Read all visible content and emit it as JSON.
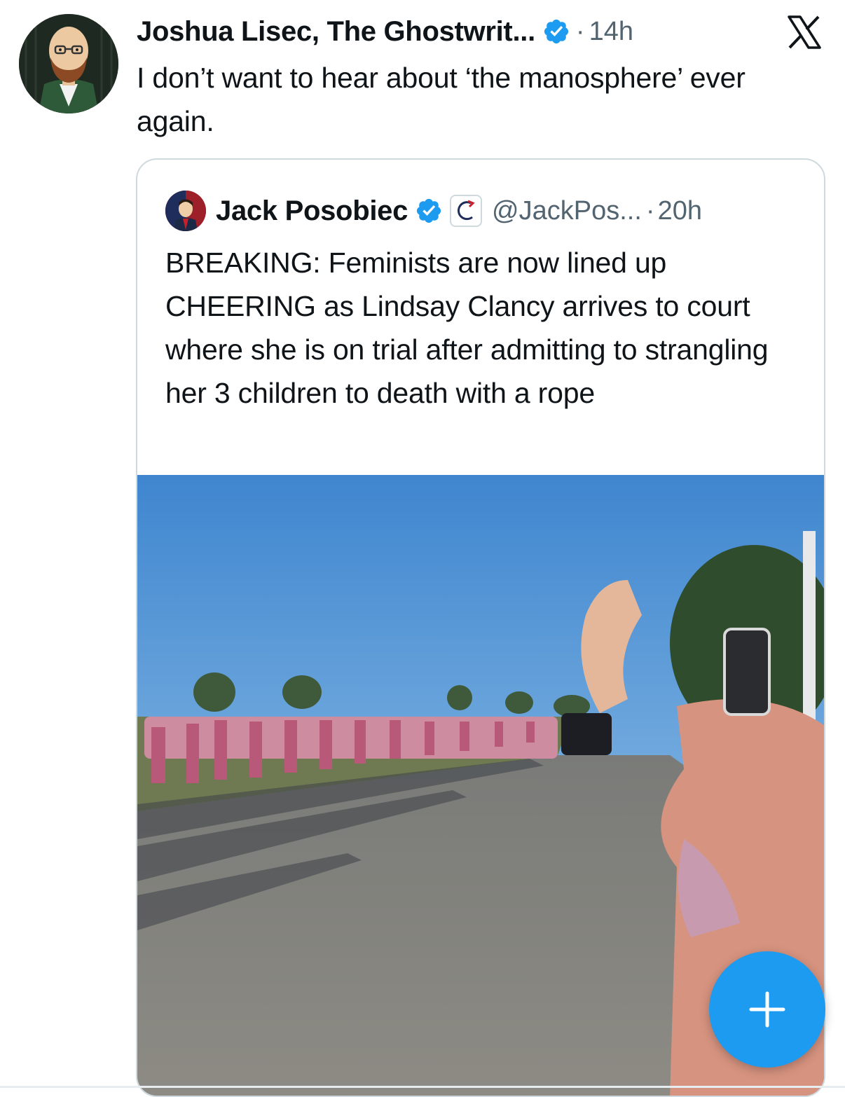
{
  "tweet": {
    "author_name": "Joshua Lisec, The Ghostwrit...",
    "separator": "·",
    "time": "14h",
    "text": "I don’t want to hear about ‘the manosphere’ ever again."
  },
  "quoted_tweet": {
    "author_name": "Jack Posobiec",
    "handle": "@JackPos...",
    "separator": "·",
    "time": "20h",
    "text": "BREAKING: Feminists are now lined up CHEERING as Lindsay Clancy arrives to court where she is on trial after admitting to strangling her 3 children to death with a rope"
  },
  "icons": {
    "verified": "verified-badge-icon",
    "x_logo": "x-logo-icon",
    "compose": "plus-icon"
  },
  "colors": {
    "accent": "#1d9bf0",
    "secondary_text": "#536471",
    "border": "#cfd9de"
  }
}
